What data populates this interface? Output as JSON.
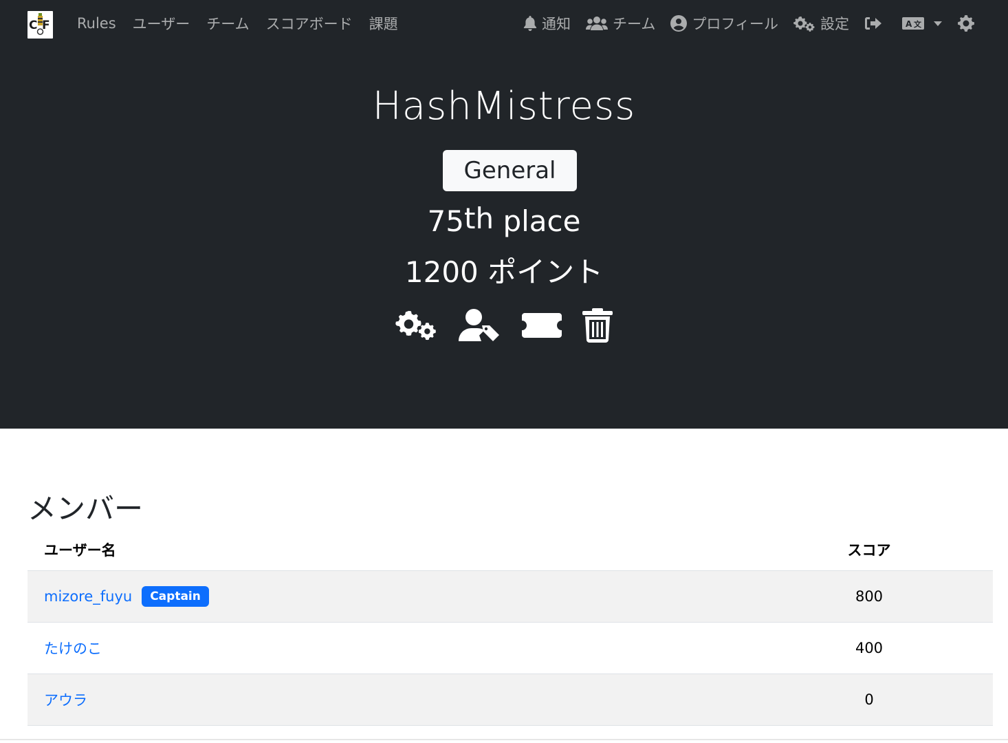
{
  "nav": {
    "logo_text_left": "C",
    "logo_text_right": "F",
    "links": [
      "Rules",
      "ユーザー",
      "チーム",
      "スコアボード",
      "課題"
    ],
    "right": {
      "notifications": "通知",
      "team": "チーム",
      "profile": "プロフィール",
      "settings": "設定"
    }
  },
  "team": {
    "name": "HashMistress",
    "bracket": "General",
    "place_number": "75",
    "place_suffix": "th",
    "place_word": "place",
    "points": "1200 ポイント"
  },
  "members": {
    "title": "メンバー",
    "columns": [
      "ユーザー名",
      "スコア"
    ],
    "rows": [
      {
        "name": "mizore_fuyu",
        "badge": "Captain",
        "score": "800"
      },
      {
        "name": "たけのこ",
        "badge": "",
        "score": "400"
      },
      {
        "name": "アウラ",
        "badge": "",
        "score": "0"
      }
    ]
  },
  "colors": {
    "navbar_bg": "#212529",
    "link_blue": "#0d6efd",
    "row_stripe": "#f2f2f2"
  },
  "icons": {
    "hero": [
      "gears-icon",
      "user-tag-icon",
      "ticket-icon",
      "trash-icon"
    ],
    "nav": [
      "bell-icon",
      "users-icon",
      "user-circle-icon",
      "gears-icon",
      "logout-icon",
      "language-icon",
      "theme-gear-icon"
    ]
  }
}
